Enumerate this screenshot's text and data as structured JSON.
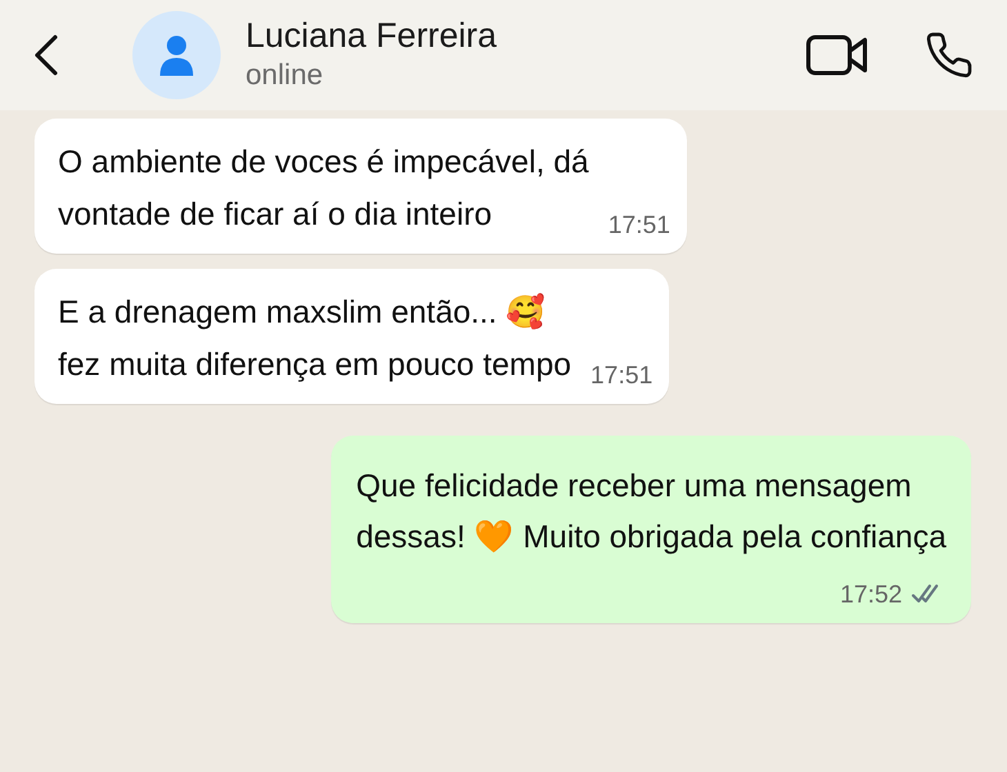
{
  "header": {
    "name": "Luciana Ferreira",
    "status": "online"
  },
  "messages": [
    {
      "kind": "received",
      "text": "O ambiente de voces é impecável, dá\nvontade de ficar aí o dia inteiro",
      "time": "17:51"
    },
    {
      "kind": "received",
      "text": "E a drenagem maxslim então... 🥰\nfez muita diferença em pouco tempo",
      "time": "17:51"
    },
    {
      "kind": "sent",
      "text": "Que felicidade receber uma mensagem\ndessas! 🧡  Muito obrigada pela confiança",
      "time": "17:52",
      "read": false
    }
  ]
}
